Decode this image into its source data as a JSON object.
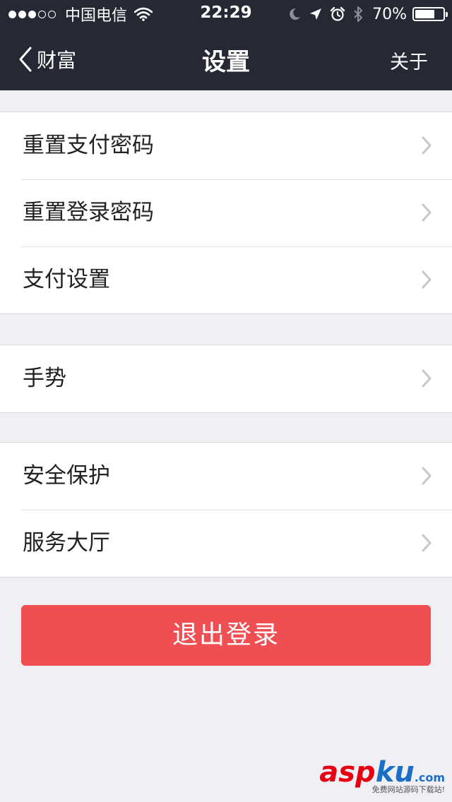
{
  "status_bar": {
    "signal_dots_filled": 3,
    "signal_dots_total": 5,
    "carrier": "中国电信",
    "time": "22:29",
    "battery_percent": "70%",
    "battery_level": 0.7,
    "icons": [
      "wifi-icon",
      "moon-icon",
      "location-arrow-icon",
      "alarm-icon",
      "bluetooth-icon",
      "battery-icon"
    ]
  },
  "nav": {
    "back_label": "财富",
    "title": "设置",
    "right_label": "关于"
  },
  "groups": [
    {
      "items": [
        {
          "label": "重置支付密码"
        },
        {
          "label": "重置登录密码"
        },
        {
          "label": "支付设置"
        }
      ]
    },
    {
      "items": [
        {
          "label": "手势"
        }
      ]
    },
    {
      "items": [
        {
          "label": "安全保护"
        },
        {
          "label": "服务大厅"
        }
      ]
    }
  ],
  "logout": {
    "label": "退出登录"
  },
  "watermark": {
    "text_a": "asp",
    "text_b": "ku",
    "suffix": ".com",
    "sub": "免费网站源码下载站!"
  },
  "colors": {
    "nav_bg": "#262833",
    "page_bg": "#efeff4",
    "logout_bg": "#ef4e52",
    "chevron": "#c7c7cc"
  }
}
